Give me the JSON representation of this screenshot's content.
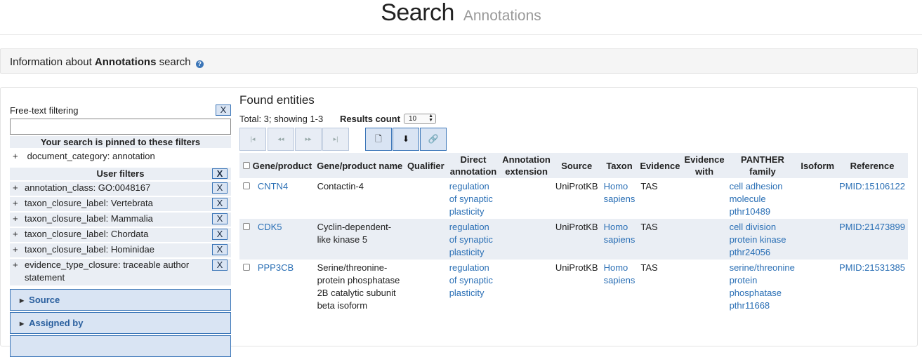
{
  "header": {
    "title": "Search",
    "subtitle": "Annotations"
  },
  "info": {
    "prefix": "Information about ",
    "bold": "Annotations",
    "suffix": " search",
    "icon": "?"
  },
  "left": {
    "freetext_label": "Free-text filtering",
    "freetext_value": "",
    "clear": "X",
    "pinned_header": "Your search is pinned to these filters",
    "pinned": [
      {
        "sign": "+",
        "text": "document_category: annotation"
      }
    ],
    "user_filters_header": "User filters",
    "user_filters": [
      {
        "sign": "+",
        "text": "annotation_class: GO:0048167"
      },
      {
        "sign": "+",
        "text": "taxon_closure_label: Vertebrata"
      },
      {
        "sign": "+",
        "text": "taxon_closure_label: Mammalia"
      },
      {
        "sign": "+",
        "text": "taxon_closure_label: Chordata"
      },
      {
        "sign": "+",
        "text": "taxon_closure_label: Hominidae"
      },
      {
        "sign": "+",
        "text": "evidence_type_closure: traceable author statement"
      }
    ],
    "accordions": [
      "Source",
      "Assigned by"
    ]
  },
  "results": {
    "title": "Found entities",
    "total": "Total: 3; showing 1-3",
    "count_label": "Results count",
    "count_value": "10",
    "pager": [
      "|◂",
      "◂◂",
      "▸▸",
      "▸|"
    ],
    "columns": [
      "Gene/product",
      "Gene/product name",
      "Qualifier",
      "Direct annotation",
      "Annotation extension",
      "Source",
      "Taxon",
      "Evidence",
      "Evidence with",
      "PANTHER family",
      "Isoform",
      "Reference"
    ],
    "rows": [
      {
        "gene": "CNTN4",
        "name": "Contactin-4",
        "qualifier": "",
        "annotation": "regulation of synaptic plasticity",
        "extension": "",
        "source": "UniProtKB",
        "taxon": "Homo sapiens",
        "evidence": "TAS",
        "evidence_with": "",
        "panther": "cell adhesion molecule pthr10489",
        "isoform": "",
        "reference": "PMID:15106122"
      },
      {
        "gene": "CDK5",
        "name": "Cyclin-dependent-like kinase 5",
        "qualifier": "",
        "annotation": "regulation of synaptic plasticity",
        "extension": "",
        "source": "UniProtKB",
        "taxon": "Homo sapiens",
        "evidence": "TAS",
        "evidence_with": "",
        "panther": "cell division protein kinase pthr24056",
        "isoform": "",
        "reference": "PMID:21473899"
      },
      {
        "gene": "PPP3CB",
        "name": "Serine/threonine-protein phosphatase 2B catalytic subunit beta isoform",
        "qualifier": "",
        "annotation": "regulation of synaptic plasticity",
        "extension": "",
        "source": "UniProtKB",
        "taxon": "Homo sapiens",
        "evidence": "TAS",
        "evidence_with": "",
        "panther": "serine/threonine protein phosphatase pthr11668",
        "isoform": "",
        "reference": "PMID:21531385"
      }
    ]
  }
}
